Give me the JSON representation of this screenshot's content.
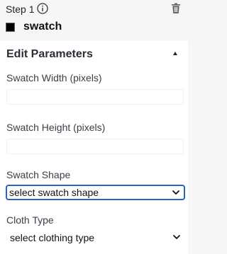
{
  "step": {
    "title": "Step 1",
    "name": "swatch",
    "color": "#000000"
  },
  "panel": {
    "title": "Edit Parameters"
  },
  "fields": {
    "width": {
      "label": "Swatch Width (pixels)",
      "value": "",
      "placeholder": ""
    },
    "height": {
      "label": "Swatch Height (pixels)",
      "value": "",
      "placeholder": ""
    },
    "shape": {
      "label": "Swatch Shape",
      "selected": "select swatch shape"
    },
    "cloth": {
      "label": "Cloth Type",
      "selected": "select clothing type"
    }
  },
  "icons": {
    "info": "info-icon",
    "delete": "trash-icon",
    "collapse": "caret-up-icon",
    "dropdown": "chevron-down-icon"
  },
  "colors": {
    "accent": "#2a63c7",
    "background": "#f6f6f7",
    "panel": "#ffffff"
  }
}
